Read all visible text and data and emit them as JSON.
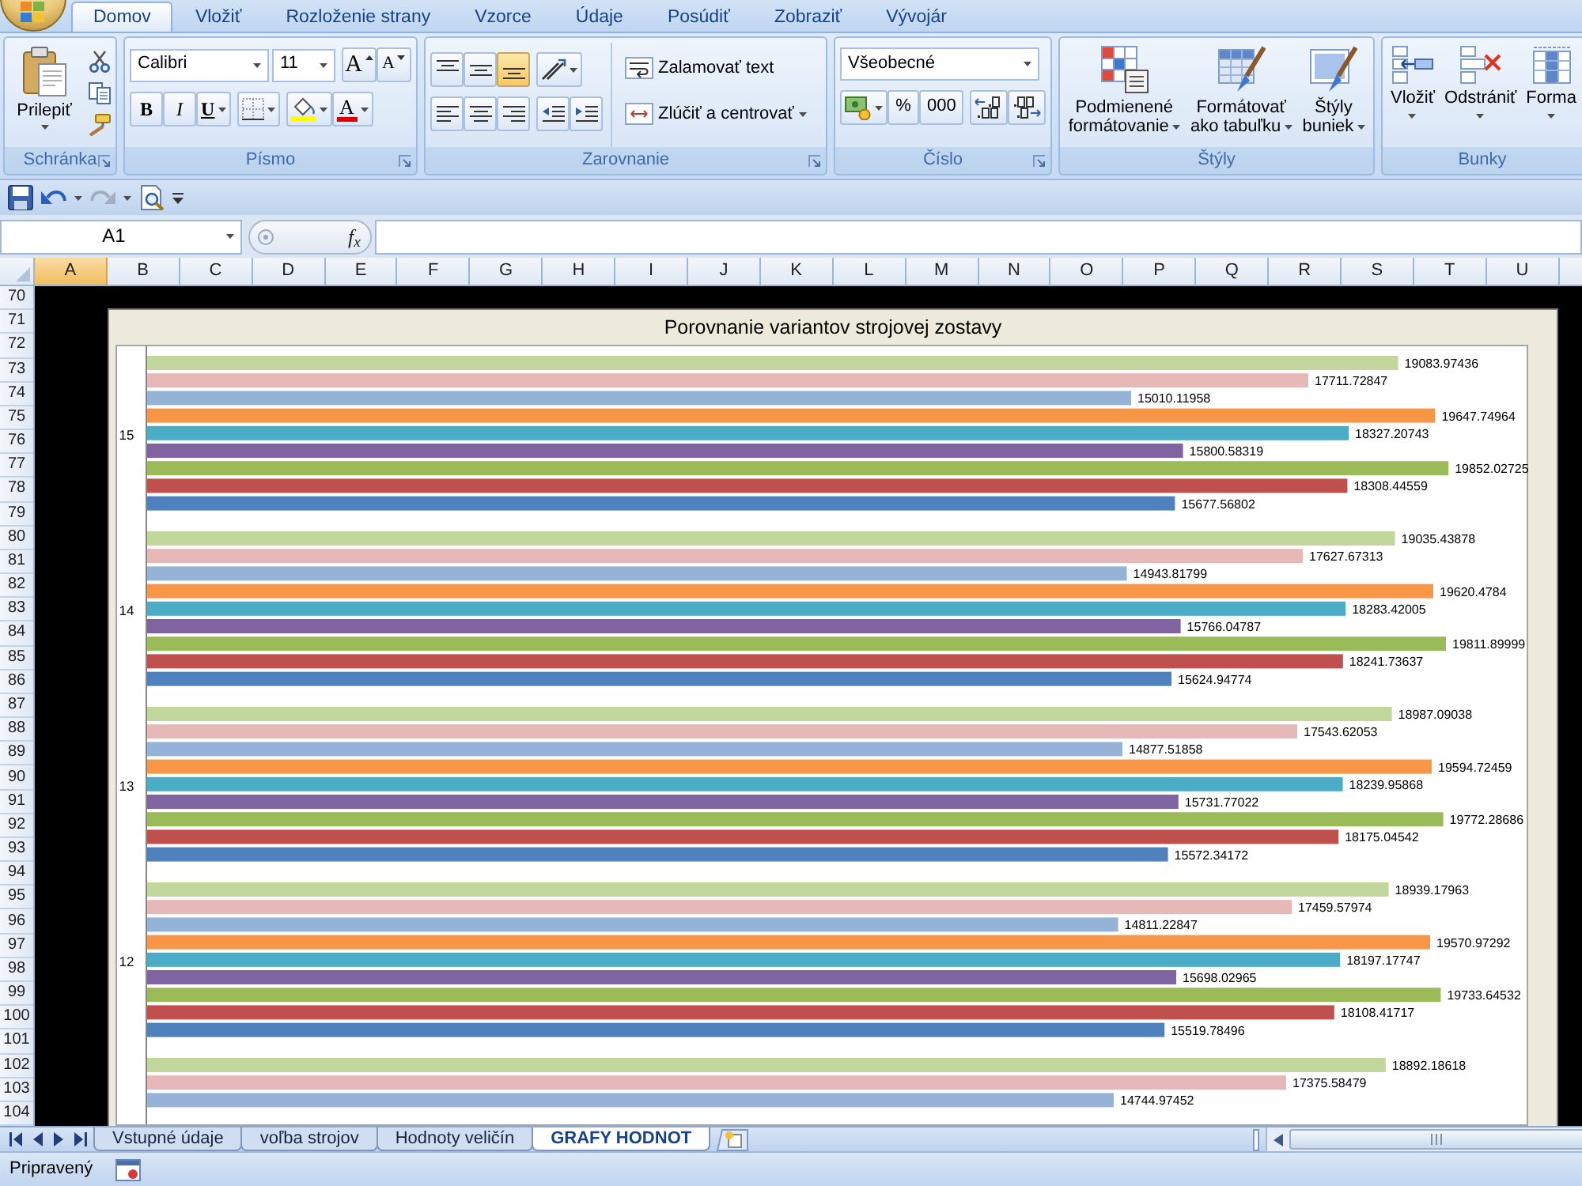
{
  "ribbon": {
    "tabs": [
      {
        "label": "Domov",
        "selected": true
      },
      {
        "label": "Vložiť",
        "selected": false
      },
      {
        "label": "Rozloženie strany",
        "selected": false
      },
      {
        "label": "Vzorce",
        "selected": false
      },
      {
        "label": "Údaje",
        "selected": false
      },
      {
        "label": "Posúdiť",
        "selected": false
      },
      {
        "label": "Zobraziť",
        "selected": false
      },
      {
        "label": "Vývojár",
        "selected": false
      }
    ],
    "groups": [
      {
        "kind": "clipboard",
        "label": "Schránka",
        "launcher": true,
        "paste_label": "Prilepiť"
      },
      {
        "kind": "font",
        "label": "Písmo",
        "launcher": true,
        "font_name": "Calibri",
        "font_size": "11",
        "grow_label": "A",
        "shrink_label": "A",
        "bold_label": "B",
        "italic_label": "I",
        "underline_label": "U",
        "font_color_label": "A"
      },
      {
        "kind": "alignment",
        "label": "Zarovnanie",
        "launcher": true,
        "vertical": [
          {
            "selected": false
          },
          {
            "selected": false
          },
          {
            "selected": true
          }
        ],
        "wrap_label": "Zalamovať text",
        "merge_label": "Zlúčiť a centrovať"
      },
      {
        "kind": "number",
        "label": "Číslo",
        "launcher": true,
        "format": "Všeobecné",
        "percent_label": "%",
        "thousands_label": "000"
      },
      {
        "kind": "styles",
        "label": "Štýly",
        "launcher": false,
        "buttons": [
          {
            "kind": "conditional",
            "label": "Podmienené\nformátovanie"
          },
          {
            "kind": "table",
            "label": "Formátovať\nako tabuľku"
          },
          {
            "kind": "cell_styles",
            "label": "Štýly\nbuniek"
          }
        ]
      },
      {
        "kind": "cells",
        "label": "Bunky",
        "launcher": false,
        "buttons": [
          {
            "kind": "insert",
            "label": "Vložiť"
          },
          {
            "kind": "delete",
            "label": "Odstrániť"
          },
          {
            "kind": "format",
            "label": "Forma"
          }
        ]
      }
    ]
  },
  "quick_access": [
    {
      "kind": "save",
      "disabled": false,
      "dropdown": false
    },
    {
      "kind": "undo",
      "disabled": false,
      "dropdown": true
    },
    {
      "kind": "redo",
      "disabled": true,
      "dropdown": true
    },
    {
      "kind": "print_preview",
      "disabled": false,
      "dropdown": false
    },
    {
      "kind": "customize",
      "disabled": false,
      "dropdown": false
    }
  ],
  "formula_bar": {
    "name_box": "A1",
    "function_label": "f$_{x}$"
  },
  "sheet": {
    "columns": [
      {
        "label": "A",
        "selected": true
      },
      {
        "label": "B",
        "selected": false
      },
      {
        "label": "C",
        "selected": false
      },
      {
        "label": "D",
        "selected": false
      },
      {
        "label": "E",
        "selected": false
      },
      {
        "label": "F",
        "selected": false
      },
      {
        "label": "G",
        "selected": false
      },
      {
        "label": "H",
        "selected": false
      },
      {
        "label": "I",
        "selected": false
      },
      {
        "label": "J",
        "selected": false
      },
      {
        "label": "K",
        "selected": false
      },
      {
        "label": "L",
        "selected": false
      },
      {
        "label": "M",
        "selected": false
      },
      {
        "label": "N",
        "selected": false
      },
      {
        "label": "O",
        "selected": false
      },
      {
        "label": "P",
        "selected": false
      },
      {
        "label": "Q",
        "selected": false
      },
      {
        "label": "R",
        "selected": false
      },
      {
        "label": "S",
        "selected": false
      },
      {
        "label": "T",
        "selected": false
      },
      {
        "label": "U",
        "selected": false
      }
    ],
    "rows": [
      {
        "label": "70",
        "selected": false
      },
      {
        "label": "71",
        "selected": false
      },
      {
        "label": "72",
        "selected": false
      },
      {
        "label": "73",
        "selected": false
      },
      {
        "label": "74",
        "selected": false
      },
      {
        "label": "75",
        "selected": false
      },
      {
        "label": "76",
        "selected": false
      },
      {
        "label": "77",
        "selected": false
      },
      {
        "label": "78",
        "selected": false
      },
      {
        "label": "79",
        "selected": false
      },
      {
        "label": "80",
        "selected": false
      },
      {
        "label": "81",
        "selected": false
      },
      {
        "label": "82",
        "selected": false
      },
      {
        "label": "83",
        "selected": false
      },
      {
        "label": "84",
        "selected": false
      },
      {
        "label": "85",
        "selected": false
      },
      {
        "label": "86",
        "selected": false
      },
      {
        "label": "87",
        "selected": false
      },
      {
        "label": "88",
        "selected": false
      },
      {
        "label": "89",
        "selected": false
      },
      {
        "label": "90",
        "selected": false
      },
      {
        "label": "91",
        "selected": false
      },
      {
        "label": "92",
        "selected": false
      },
      {
        "label": "93",
        "selected": false
      },
      {
        "label": "94",
        "selected": false
      },
      {
        "label": "95",
        "selected": false
      },
      {
        "label": "96",
        "selected": false
      },
      {
        "label": "97",
        "selected": false
      },
      {
        "label": "98",
        "selected": false
      },
      {
        "label": "99",
        "selected": false
      },
      {
        "label": "100",
        "selected": false
      },
      {
        "label": "101",
        "selected": false
      },
      {
        "label": "102",
        "selected": false
      },
      {
        "label": "103",
        "selected": false
      },
      {
        "label": "104",
        "selected": false
      }
    ],
    "chart": {
      "title": "Porovnanie variantov strojovej zostavy",
      "chart_data": {
        "type": "bar",
        "orientation": "horizontal",
        "categories": [
          "15",
          "14",
          "13",
          "12",
          null
        ],
        "series": [
          {
            "color": "#c3d69b",
            "values": [
              19083.97436,
              19035.43878,
              18987.09038,
              18939.17963,
              18892.18618
            ]
          },
          {
            "color": "#e6b9b8",
            "values": [
              17711.72847,
              17627.67313,
              17543.62053,
              17459.57974,
              17375.58479
            ]
          },
          {
            "color": "#95b3d7",
            "values": [
              15010.11958,
              14943.81799,
              14877.51858,
              14811.22847,
              14744.97452
            ]
          },
          {
            "color": "#f79646",
            "values": [
              19647.74964,
              19620.4784,
              19594.72459,
              19570.97292,
              null
            ]
          },
          {
            "color": "#4bacc6",
            "values": [
              18327.20743,
              18283.42005,
              18239.95868,
              18197.17747,
              null
            ]
          },
          {
            "color": "#8064a2",
            "values": [
              15800.58319,
              15766.04787,
              15731.77022,
              15698.02965,
              null
            ]
          },
          {
            "color": "#9bbb59",
            "values": [
              19852.02725,
              19811.89999,
              19772.28686,
              19733.64532,
              null
            ]
          },
          {
            "color": "#c0504d",
            "values": [
              18308.44559,
              18241.73637,
              18175.04542,
              18108.41717,
              null
            ]
          },
          {
            "color": "#4f81bd",
            "values": [
              15677.56802,
              15624.94774,
              15572.34172,
              15519.78496,
              null
            ]
          }
        ],
        "data_labels": true
      }
    }
  },
  "sheet_tabs": [
    {
      "label": "Vstupné údaje",
      "selected": false
    },
    {
      "label": "voľba strojov",
      "selected": false
    },
    {
      "label": "Hodnoty veličín",
      "selected": false
    },
    {
      "label": "GRAFY HODNOT",
      "selected": true
    }
  ],
  "status_bar": {
    "text": "Pripravený"
  }
}
